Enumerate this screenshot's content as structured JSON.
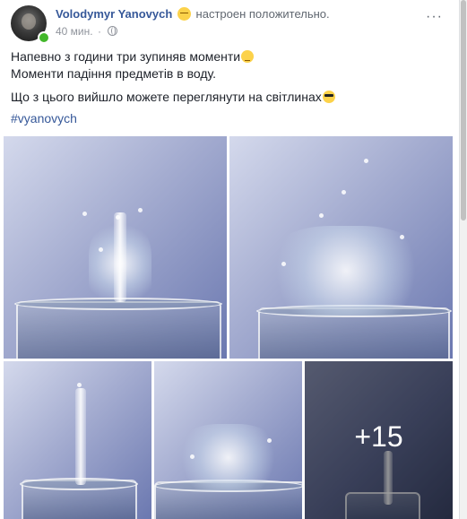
{
  "post": {
    "author": "Volodymyr Yanovych",
    "feeling": "настроен положительно.",
    "time": "40 мин.",
    "privacy_icon": "globe-icon",
    "more_icon": "ellipsis-icon",
    "more_glyph": "···",
    "text_lines": [
      "Напевно з години три зупиняв моменти",
      "Моменти падіння предметів в воду.",
      "Що з цього вийшло можете переглянути на світлинах"
    ],
    "hashtag": "#vyanovych"
  },
  "photos": {
    "extra_count": "+15"
  },
  "colors": {
    "link": "#365899",
    "text": "#1d2129",
    "meta": "#90949c",
    "online": "#42b72a"
  }
}
